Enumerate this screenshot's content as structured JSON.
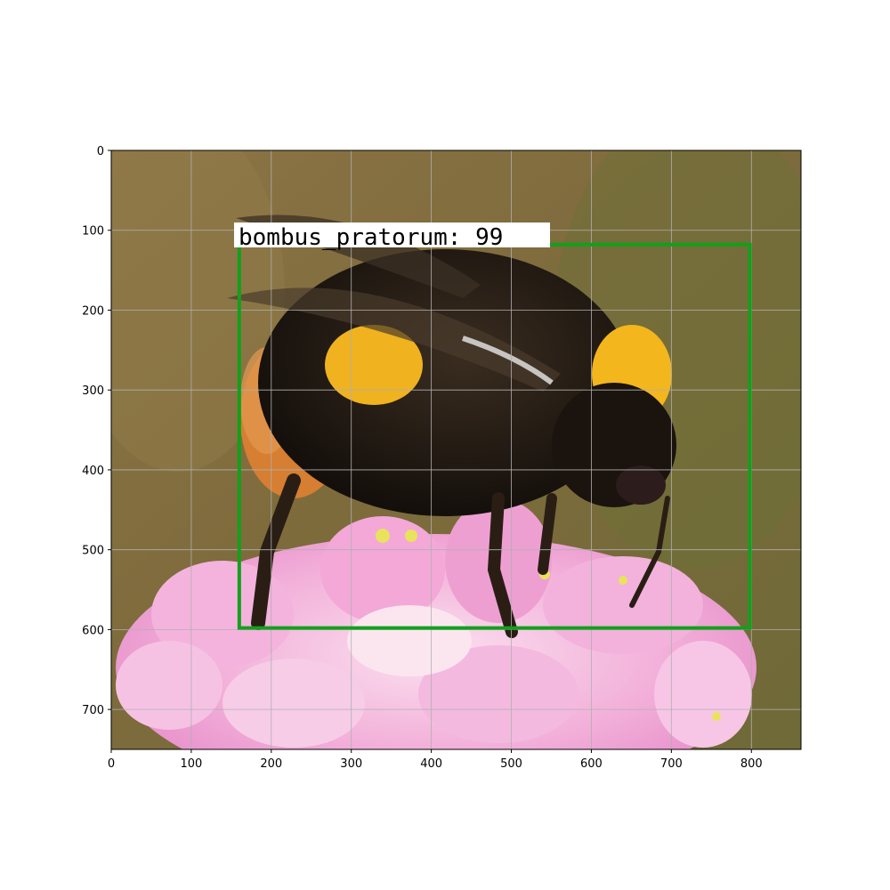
{
  "figure": {
    "x_ticks": [
      "0",
      "100",
      "200",
      "300",
      "400",
      "500",
      "600",
      "700",
      "800"
    ],
    "y_ticks": [
      "0",
      "100",
      "200",
      "300",
      "400",
      "500",
      "600",
      "700"
    ],
    "x_range": [
      0,
      862
    ],
    "y_range": [
      750,
      0
    ],
    "grid": true
  },
  "image": {
    "subject": "bumblebee on pink thrift flower",
    "background_color": "#8a7440",
    "flower_color": "#f0a6d8",
    "bee_body_color": "#1d1712",
    "bee_yellow_color": "#f2b51e",
    "bee_orange_color": "#d97a2a"
  },
  "detection": {
    "label": "bombus_pratorum: 99",
    "box_color": "#12a01c",
    "box_data": {
      "x_min": 160,
      "y_min": 118,
      "x_max": 798,
      "y_max": 598
    }
  }
}
